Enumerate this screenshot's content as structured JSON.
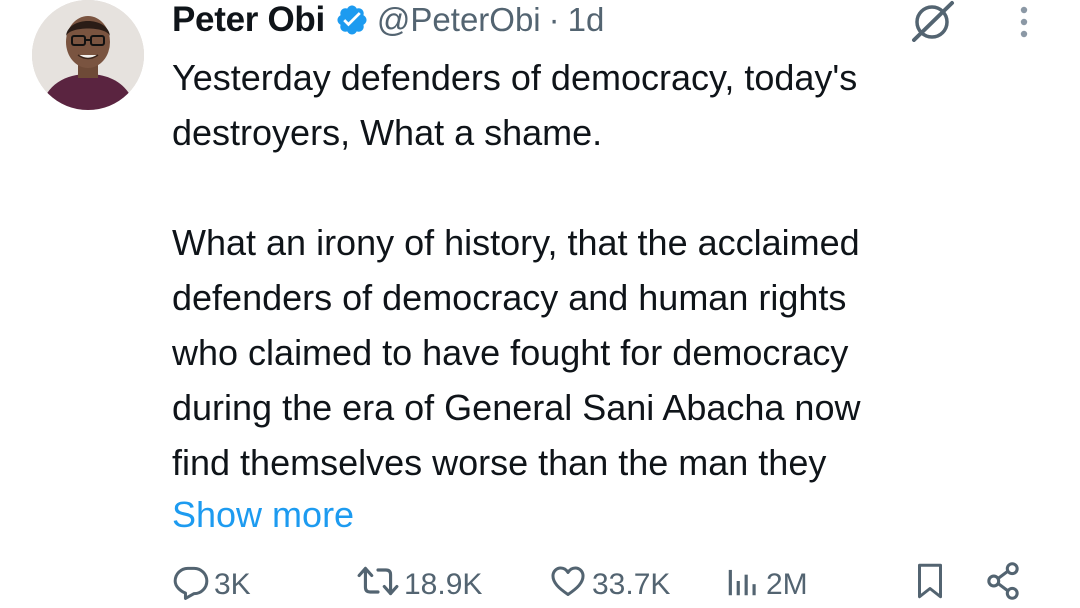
{
  "author": {
    "name": "Peter Obi",
    "handle": "@PeterObi",
    "separator": "·",
    "time": "1d",
    "verified": true,
    "avatar": "avatar-photo"
  },
  "tweet": {
    "paragraphs": [
      "Yesterday defenders of democracy, today's\ndestroyers, What a shame.",
      "What an irony of history, that the acclaimed\ndefenders of democracy and human rights\nwho claimed to have fought for democracy\nduring the era of General Sani Abacha now\nfind themselves worse than the man they"
    ],
    "show_more": "Show more"
  },
  "actions": {
    "replies": "3K",
    "reposts": "18.9K",
    "likes": "33.7K",
    "views": "2M"
  },
  "icons": {
    "verified": "verified-badge-icon",
    "grok": "grok-icon",
    "more": "more-vertical-icon",
    "reply": "reply-icon",
    "repost": "repost-icon",
    "like": "heart-icon",
    "views": "views-icon",
    "bookmark": "bookmark-icon",
    "share": "share-icon"
  },
  "colors": {
    "text": "#0f1419",
    "secondary": "#536471",
    "link": "#1d9bf0",
    "verified": "#1d9bf0"
  }
}
